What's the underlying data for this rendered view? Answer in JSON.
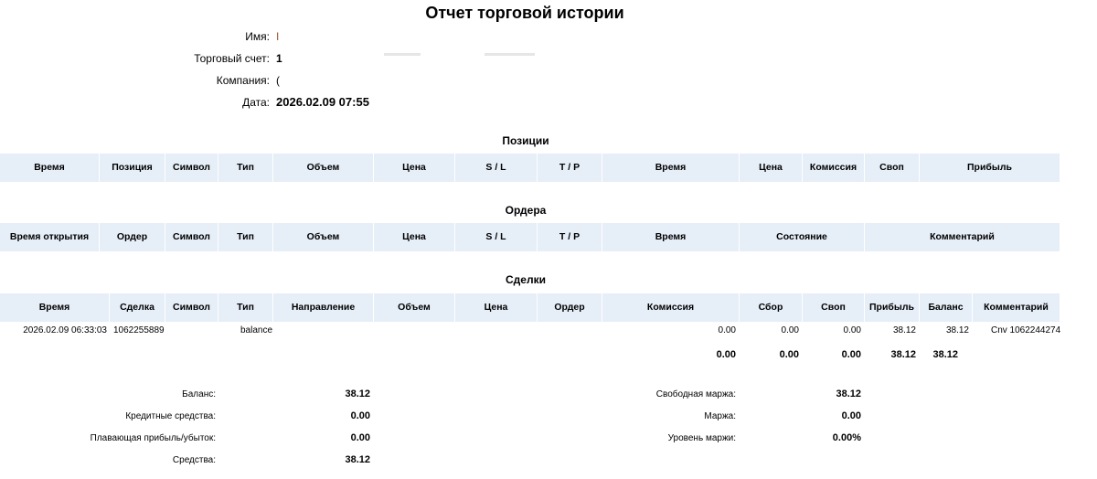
{
  "report_title": "Отчет торговой истории",
  "info": {
    "name_label": "Имя:",
    "name_value": "I",
    "account_label": "Торговый счет:",
    "account_value": "1",
    "company_label": "Компания:",
    "company_value": "(",
    "date_label": "Дата:",
    "date_value": "2026.02.09 07:55"
  },
  "positions": {
    "title": "Позиции",
    "columns": [
      "Время",
      "Позиция",
      "Символ",
      "Тип",
      "Объем",
      "Цена",
      "S / L",
      "T / P",
      "Время",
      "Цена",
      "Комиссия",
      "Своп",
      "Прибыль"
    ]
  },
  "orders": {
    "title": "Ордера",
    "columns": [
      "Время открытия",
      "Ордер",
      "Символ",
      "Тип",
      "Объем",
      "Цена",
      "S / L",
      "T / P",
      "Время",
      "Состояние",
      "Комментарий"
    ]
  },
  "deals": {
    "title": "Сделки",
    "columns": [
      "Время",
      "Сделка",
      "Символ",
      "Тип",
      "Направление",
      "Объем",
      "Цена",
      "Ордер",
      "Комиссия",
      "Сбор",
      "Своп",
      "Прибыль",
      "Баланс",
      "Комментарий"
    ],
    "rows": [
      {
        "time": "2026.02.09 06:33:03",
        "deal": "1062255889",
        "symbol": "",
        "type": "balance",
        "direction": "",
        "volume": "",
        "price": "",
        "order": "",
        "commission": "0.00",
        "fee": "0.00",
        "swap": "0.00",
        "profit": "38.12",
        "balance": "38.12",
        "comment": "Cnv 1062244274"
      }
    ],
    "totals": {
      "commission": "0.00",
      "fee": "0.00",
      "swap": "0.00",
      "profit": "38.12",
      "balance": "38.12"
    }
  },
  "summary": {
    "balance_label": "Баланс:",
    "balance_value": "38.12",
    "credit_label": "Кредитные средства:",
    "credit_value": "0.00",
    "floating_label": "Плавающая прибыль/убыток:",
    "floating_value": "0.00",
    "equity_label": "Средства:",
    "equity_value": "38.12",
    "free_margin_label": "Свободная маржа:",
    "free_margin_value": "38.12",
    "margin_label": "Маржа:",
    "margin_value": "0.00",
    "margin_level_label": "Уровень маржи:",
    "margin_level_value": "0.00%"
  }
}
